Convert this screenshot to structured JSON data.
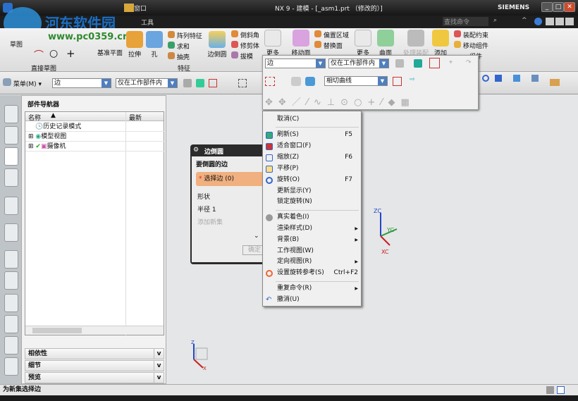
{
  "window": {
    "title": "NX 9 - 建模 - [_asm1.prt （修改的）]",
    "brand": "SIEMENS",
    "search_placeholder": "查找命令",
    "window_menu": "窗口",
    "tools_tab": "工具"
  },
  "watermark": {
    "name": "河东软件园",
    "url": "www.pc0359.cn"
  },
  "ribbon": {
    "sketch": "草图",
    "direct_sketch": "直接草图",
    "datum_plane": "基准平面",
    "extrude": "拉伸",
    "hole": "孔",
    "pattern_feature": "阵列特征",
    "unite": "求和",
    "shell": "抽壳",
    "edge_blend": "边倒圆",
    "chamfer": "倒斜角",
    "trim_body": "修剪体",
    "draft": "拔模",
    "feature_group": "特征",
    "more1": "更多",
    "move_face": "移动面",
    "offset_region": "偏置区域",
    "replace_face": "替换面",
    "more2": "更多",
    "surface": "曲面",
    "process_assembly": "处理装配",
    "add": "添加",
    "assembly_constraint": "装配约束",
    "move_component": "移动组件",
    "other_component": "组件"
  },
  "toolbar": {
    "menu": "菜单(M)",
    "filter": "边",
    "scope": "仅在工作部件内"
  },
  "popup": {
    "filter": "边",
    "scope": "仅在工作部件内",
    "curve_rule": "相切曲线"
  },
  "navigator": {
    "title": "部件导航器",
    "col_name": "名称",
    "col_latest": "最新",
    "items": [
      "历史记录模式",
      "模型视图",
      "摄像机"
    ],
    "sections": [
      "相依性",
      "细节",
      "预览"
    ]
  },
  "dialog": {
    "title": "边倒圆",
    "section": "要倒圆的边",
    "select_edge": "选择边 (0)",
    "shape": "形状",
    "radius_label": "半径 1",
    "add_set": "添加新集",
    "ok": "确定"
  },
  "context_menu": {
    "items": [
      {
        "label": "取消(C)",
        "key": ""
      },
      {
        "label": "刷新(S)",
        "key": "F5"
      },
      {
        "label": "适合窗口(F)",
        "key": ""
      },
      {
        "label": "缩放(Z)",
        "key": "F6"
      },
      {
        "label": "平移(P)",
        "key": ""
      },
      {
        "label": "旋转(O)",
        "key": "F7"
      },
      {
        "label": "更新显示(Y)",
        "key": ""
      },
      {
        "label": "锁定旋转(N)",
        "key": ""
      },
      {
        "label": "真实着色(I)",
        "key": ""
      },
      {
        "label": "渲染样式(D)",
        "key": ""
      },
      {
        "label": "背景(B)",
        "key": ""
      },
      {
        "label": "工作视图(W)",
        "key": ""
      },
      {
        "label": "定向视图(R)",
        "key": ""
      },
      {
        "label": "设置旋转参考(S)",
        "key": "Ctrl+F2"
      },
      {
        "label": "重复命令(R)",
        "key": ""
      },
      {
        "label": "撤消(U)",
        "key": ""
      }
    ]
  },
  "triad": {
    "z": "ZC",
    "y": "YC",
    "x": "XC",
    "small_z": "Z",
    "small_x": "X"
  },
  "status": {
    "prompt": "为新集选择边"
  }
}
